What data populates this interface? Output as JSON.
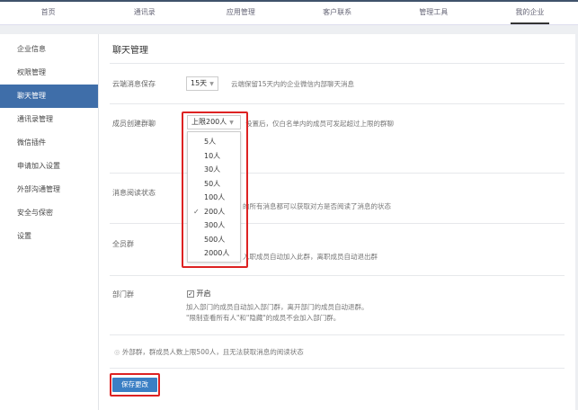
{
  "topnav": {
    "tabs": [
      "首页",
      "通讯录",
      "应用管理",
      "客户联系",
      "管理工具",
      "我的企业"
    ],
    "active": 5
  },
  "sidebar": {
    "items": [
      "企业信息",
      "权限管理",
      "聊天管理",
      "通讯录管理",
      "微信插件",
      "申请加入设置",
      "外部沟通管理",
      "安全与保密",
      "设置"
    ],
    "active": 2
  },
  "main": {
    "title": "聊天管理",
    "cloud": {
      "label": "云端消息保存",
      "value": "15天",
      "desc": "云端保留15天内的企业微信内部聊天消息"
    },
    "create": {
      "label": "成员创建群聊",
      "value": "上限200人",
      "desc": "设置后，仅白名单内的成员可发起超过上限的群聊",
      "options": [
        "5人",
        "10人",
        "30人",
        "50人",
        "100人",
        "200人",
        "300人",
        "500人",
        "2000人"
      ],
      "selected": "200人"
    },
    "read": {
      "label": "消息阅读状态",
      "desc": "的所有消息都可以获取对方是否阅读了消息的状态"
    },
    "all": {
      "label": "全员群",
      "desc": "入职成员自动加入此群，离职成员自动退出群"
    },
    "dept": {
      "label": "部门群",
      "checkbox_label": "开启",
      "checked": true,
      "desc1": "加入部门的成员自动加入部门群，离开部门的成员自动退群。",
      "desc2": "\"限制查看所有人\"和\"隐藏\"的成员不会加入部门群。"
    },
    "note": "外部群，群成员人数上限500人，且无法获取消息的阅读状态",
    "save": "保存更改"
  },
  "colors": {
    "accent": "#3f6ea9",
    "highlight": "#dd2222"
  }
}
